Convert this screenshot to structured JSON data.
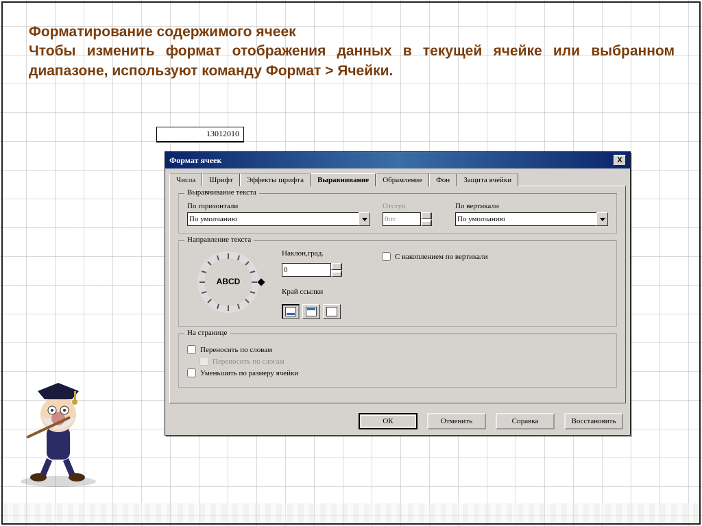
{
  "slide": {
    "line1": "Форматирование содержимого ячеек",
    "line2": "Чтобы изменить формат отображения данных в текущей ячейке или выбранном диапазоне, используют команду Формат > Ячейки."
  },
  "cell_value": "13012010",
  "dialog": {
    "title": "Формат ячеек",
    "close": "X",
    "tabs": {
      "t1": "Числа",
      "t2": "Шрифт",
      "t3": "Эффекты шрифта",
      "t4": "Выравнивание",
      "t5": "Обрамление",
      "t6": "Фон",
      "t7": "Защита ячейки"
    },
    "group_align": "Выравнивание текста",
    "horiz_label": "По горизонтали",
    "horiz_value": "По умолчанию",
    "indent_label": "Отступ",
    "indent_value": "0пт",
    "vert_label": "По вертикали",
    "vert_value": "По умолчанию",
    "group_dir": "Направление текста",
    "dial_text": "ABCD",
    "angle_label": "Наклон,град.",
    "angle_value": "0",
    "ref_label": "Край ссылки",
    "stack_label": "С накоплением по вертикали",
    "group_page": "На странице",
    "wrap_words": "Переносить по словам",
    "wrap_syll": "Переносить по слогам",
    "shrink": "Уменьшить по размеру ячейки",
    "btn_ok": "ОК",
    "btn_cancel": "Отменить",
    "btn_help": "Справка",
    "btn_reset": "Восстановить"
  }
}
